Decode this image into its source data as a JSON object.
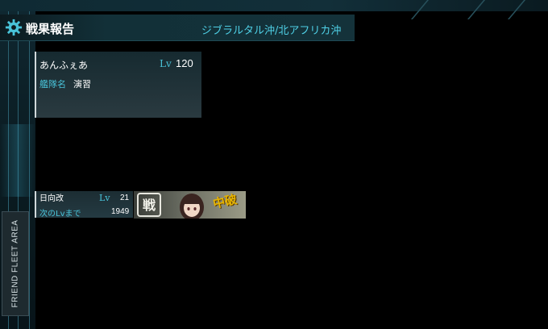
{
  "header": {
    "title": "戦果報告",
    "area_name": "ジブラルタル沖/北アフリカ沖"
  },
  "admiral": {
    "name": "あんふぇあ",
    "lv_label": "Lv",
    "level": "120",
    "fleet_label": "艦隊名",
    "fleet_name": "演習"
  },
  "ship": {
    "name": "日向改",
    "lv_label": "Lv",
    "level": "21",
    "next_label": "次のLvまで",
    "next_exp": "1949",
    "stamp_text": "戦",
    "damage_status": "中破"
  },
  "sidebar": {
    "area_tab_label": "FRIEND FLEET AREA"
  },
  "colors": {
    "accent": "#49c3d9",
    "damage": "#e6b400",
    "background": "#000000"
  },
  "icons": {
    "header_icon": "gear-icon",
    "stamp_icon": "battle-stamp-icon"
  }
}
